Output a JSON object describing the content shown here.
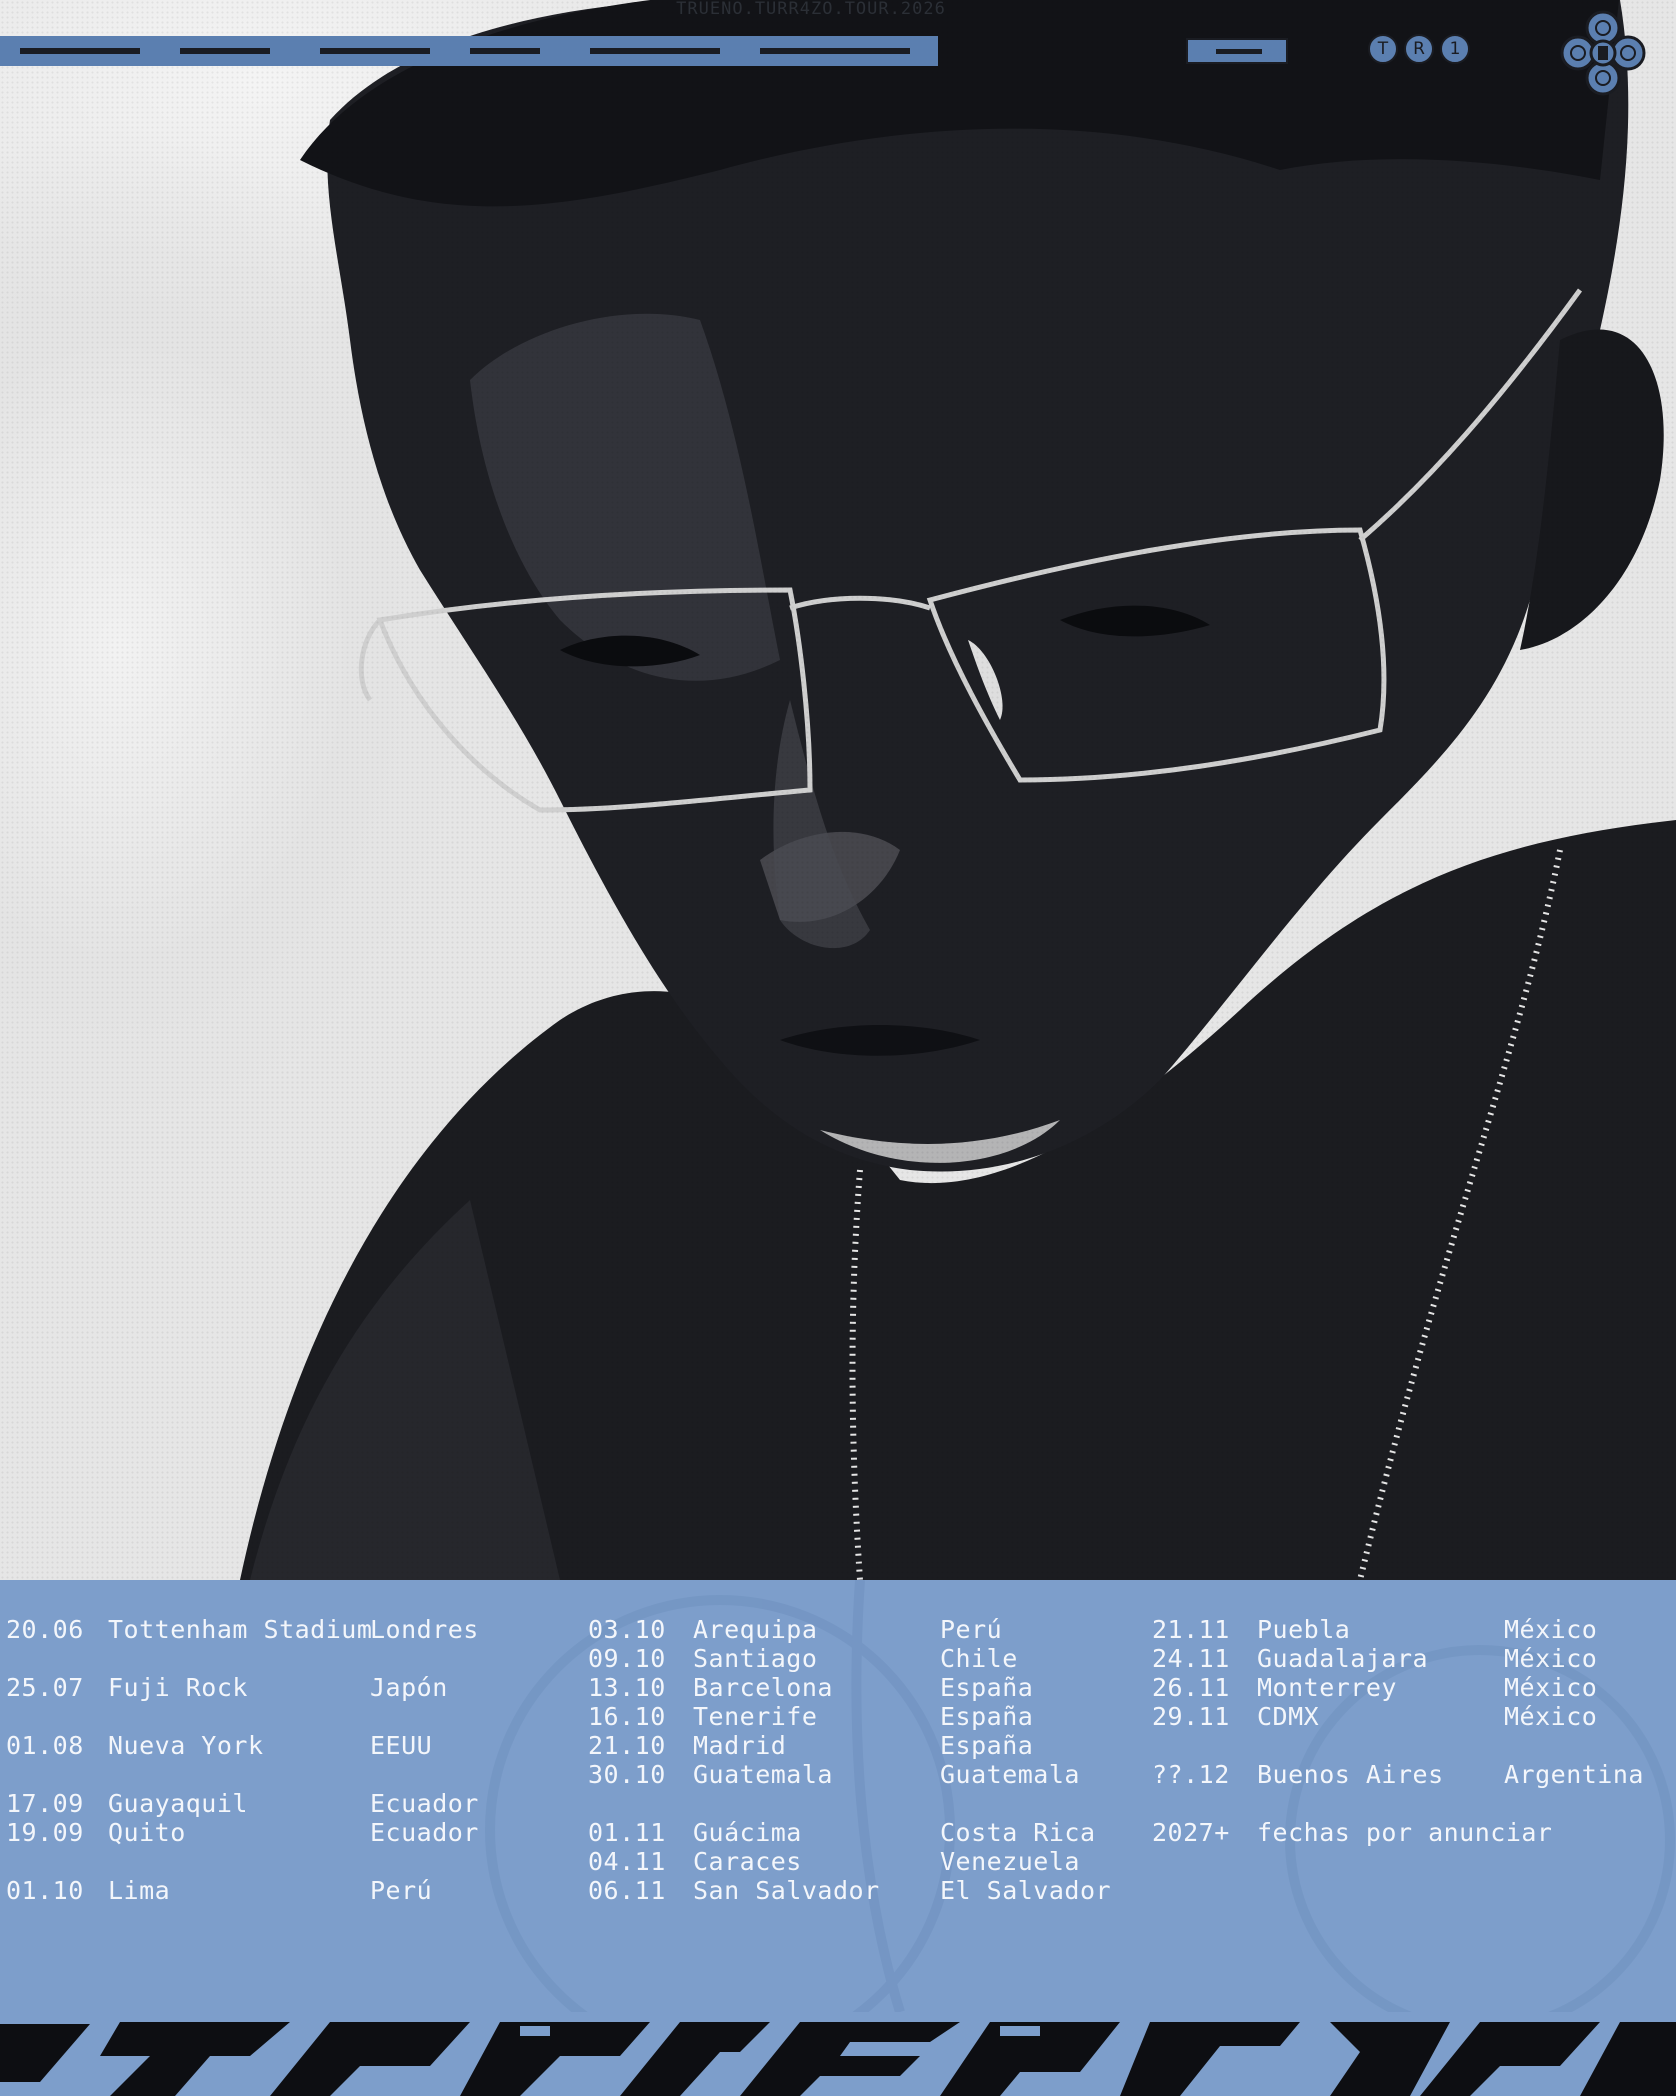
{
  "header": {
    "title_text": "TRUENO.TURR4ZO.TOUR.2026",
    "wordmark": "TURR4ZO",
    "badge_letters": [
      "T",
      "R",
      "1"
    ]
  },
  "colors": {
    "accent_blue": "#7d9ecb",
    "dark_blue": "#5b7fb0",
    "ink": "#1a1c22"
  },
  "tour": {
    "col1": [
      {
        "date": "20.06",
        "venue": "Tottenham Stadium",
        "place": "Londres"
      },
      {
        "date": "25.07",
        "venue": "Fuji Rock",
        "place": "Japón"
      },
      {
        "date": "01.08",
        "venue": "Nueva York",
        "place": "EEUU"
      },
      {
        "date": "17.09",
        "venue": "Guayaquil",
        "place": "Ecuador"
      },
      {
        "date": "19.09",
        "venue": "Quito",
        "place": "Ecuador"
      },
      {
        "date": "01.10",
        "venue": "Lima",
        "place": "Perú"
      }
    ],
    "col2": [
      {
        "date": "03.10",
        "venue": "Arequipa",
        "place": "Perú"
      },
      {
        "date": "09.10",
        "venue": "Santiago",
        "place": "Chile"
      },
      {
        "date": "13.10",
        "venue": "Barcelona",
        "place": "España"
      },
      {
        "date": "16.10",
        "venue": "Tenerife",
        "place": "España"
      },
      {
        "date": "21.10",
        "venue": "Madrid",
        "place": "España"
      },
      {
        "date": "30.10",
        "venue": "Guatemala",
        "place": "Guatemala"
      },
      {
        "date": "01.11",
        "venue": "Guácima",
        "place": "Costa Rica"
      },
      {
        "date": "04.11",
        "venue": "Caraces",
        "place": "Venezuela"
      },
      {
        "date": "06.11",
        "venue": "San Salvador",
        "place": "El Salvador"
      }
    ],
    "col3": [
      {
        "date": "21.11",
        "venue": "Puebla",
        "place": "México"
      },
      {
        "date": "24.11",
        "venue": "Guadalajara",
        "place": "México"
      },
      {
        "date": "26.11",
        "venue": "Monterrey",
        "place": "México"
      },
      {
        "date": "29.11",
        "venue": "CDMX",
        "place": "México"
      },
      {
        "date": "??.12",
        "venue": "Buenos Aires",
        "place": "Argentina"
      },
      {
        "date": "2027+",
        "venue": "fechas por anunciar",
        "place": ""
      }
    ]
  },
  "footer": {
    "wordmark": "TRUENO"
  }
}
